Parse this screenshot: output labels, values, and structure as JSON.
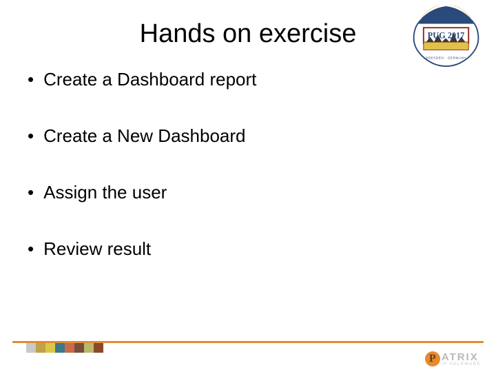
{
  "title": "Hands on exercise",
  "bullets": [
    "Create a Dashboard report",
    "Create a New Dashboard",
    "Assign the user",
    "Review result"
  ],
  "badge": {
    "label": "PUG 2017",
    "location": "DRESDEN · GERMANY"
  },
  "logo": {
    "mark": "P",
    "brand": "ATRIX",
    "sub": "IP HELPWARE"
  },
  "footerSquares": [
    "#c9c9c9",
    "#bfa24a",
    "#d9c74a",
    "#3a7a8a",
    "#c96a4a",
    "#7a4d3a",
    "#b9b96a",
    "#8a4a2a"
  ]
}
